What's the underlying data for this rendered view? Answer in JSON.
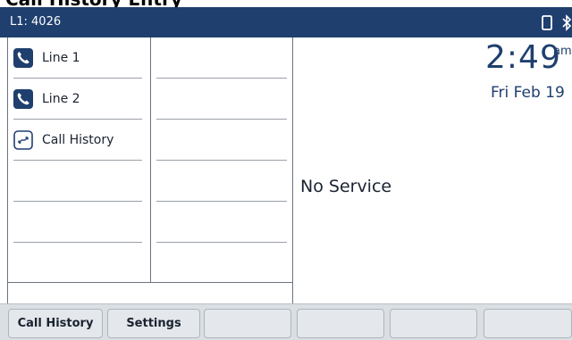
{
  "caption": "Call History Entry",
  "status_bar": {
    "line_id": "L1: 4026",
    "icons": [
      "phone-handset-icon",
      "bluetooth-icon"
    ]
  },
  "line_keys": [
    {
      "label": "Line 1",
      "icon": "phone-handset-icon"
    },
    {
      "label": "Line 2",
      "icon": "phone-handset-icon"
    },
    {
      "label": "Call History",
      "icon": "call-history-icon"
    }
  ],
  "clock": {
    "time": "2:49",
    "ampm": "am",
    "date": "Fri Feb 19"
  },
  "status_message": "No Service",
  "softkeys": [
    {
      "label": "Call History"
    },
    {
      "label": "Settings"
    },
    {
      "label": ""
    },
    {
      "label": ""
    },
    {
      "label": ""
    },
    {
      "label": ""
    }
  ],
  "colors": {
    "status_bar_bg": "#1f3f6e",
    "accent": "#1f3f6e",
    "softkey_bar_bg": "#dadfe4"
  }
}
